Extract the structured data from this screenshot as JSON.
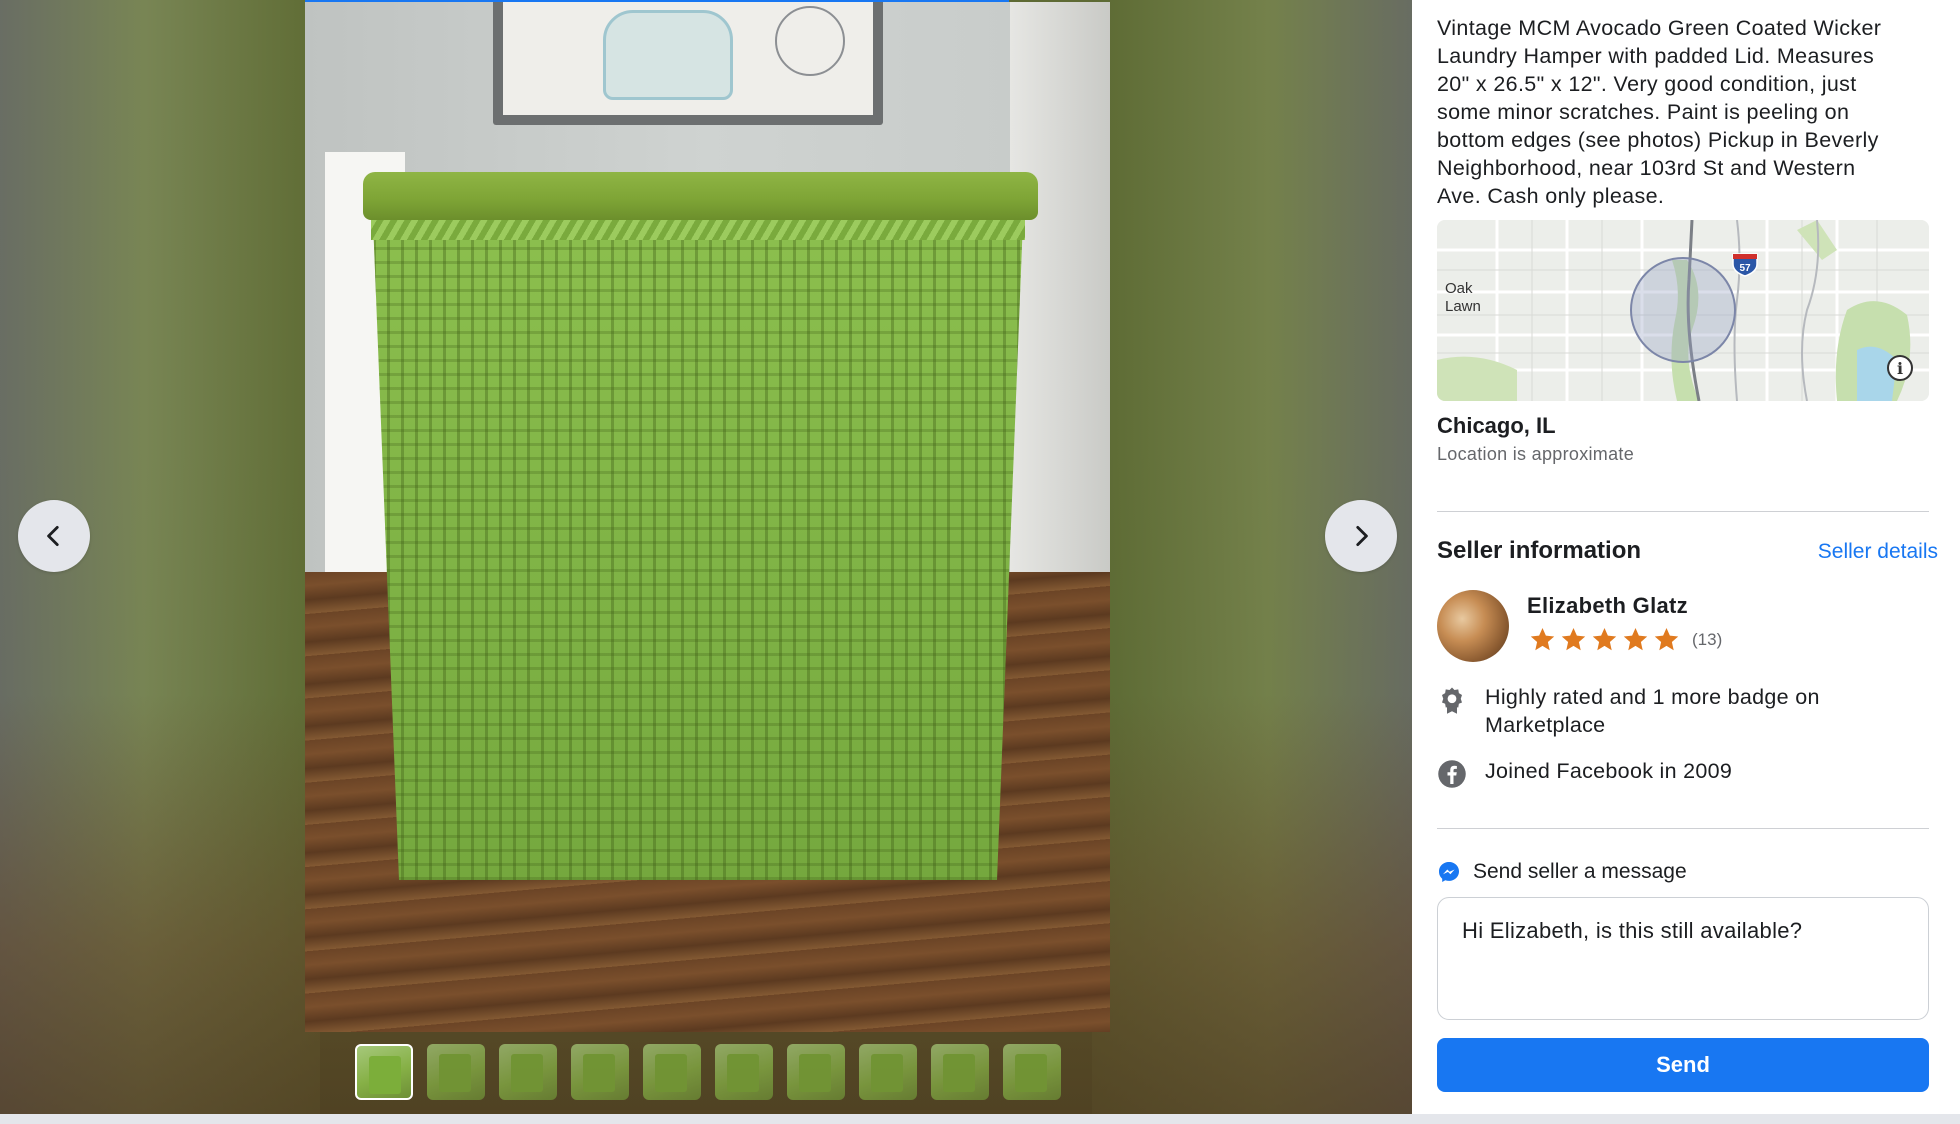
{
  "listing": {
    "description": "Vintage MCM Avocado Green Coated Wicker\nLaundry Hamper with padded Lid. Measures\n20\" x 26.5\" x 12\".  Very good condition, just\nsome minor scratches.  Paint is peeling on\nbottom edges (see photos)  Pickup in Beverly\nNeighborhood, near 103rd St and Western\nAve.  Cash only please."
  },
  "map": {
    "place_label": "Oak\nLawn",
    "highway_shield": "57",
    "info_icon": "info-icon"
  },
  "location": {
    "city": "Chicago, IL",
    "note": "Location is approximate"
  },
  "seller": {
    "heading": "Seller information",
    "details_link": "Seller details",
    "name": "Elizabeth Glatz",
    "rating_stars": 5,
    "rating_count": "(13)",
    "badge_text": "Highly rated and 1 more badge on Marketplace",
    "joined_text": "Joined Facebook in 2009"
  },
  "message": {
    "header": "Send seller a message",
    "input_value": "Hi Elizabeth, is this still available?",
    "send_label": "Send"
  },
  "gallery": {
    "prev_icon": "chevron-left-icon",
    "next_icon": "chevron-right-icon",
    "thumbnail_count": 10,
    "active_thumbnail": 1
  },
  "colors": {
    "accent": "#1877f2",
    "star": "#e07a1f",
    "text_primary": "#1c1e21",
    "text_secondary": "#65676b"
  }
}
